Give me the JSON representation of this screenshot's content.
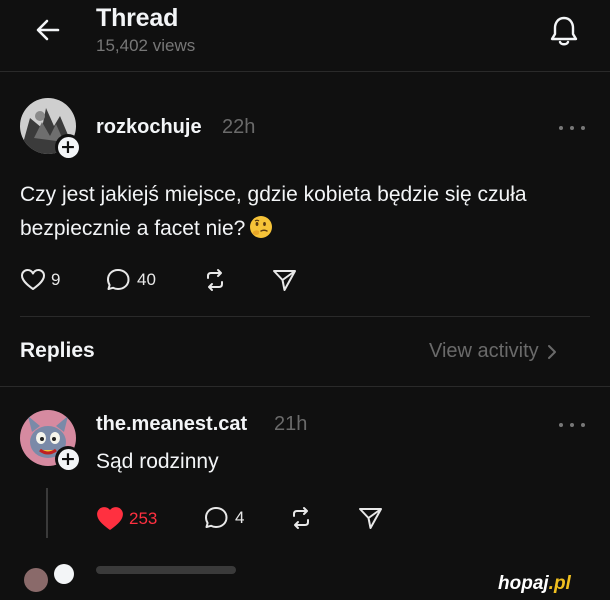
{
  "header": {
    "title": "Thread",
    "views": "15,402 views"
  },
  "post": {
    "username": "rozkochuje",
    "time": "22h",
    "text": "Czy jest jakiejś miejsce, gdzie kobieta będzie się czuła bezpiecznie a facet nie?",
    "emoji": "thinking-face",
    "likes": "9",
    "comments": "40"
  },
  "replies_section": {
    "label": "Replies",
    "view_activity": "View activity"
  },
  "reply": {
    "username": "the.meanest.cat",
    "time": "21h",
    "text": "Sąd rodzinny",
    "likes": "253",
    "comments": "4",
    "liked": true
  },
  "watermark": {
    "text": "hopaj",
    "suffix": ".pl"
  },
  "colors": {
    "background": "#101010",
    "text": "#f3f5f7",
    "muted": "#6a6a6a",
    "like_red": "#ff3040"
  }
}
